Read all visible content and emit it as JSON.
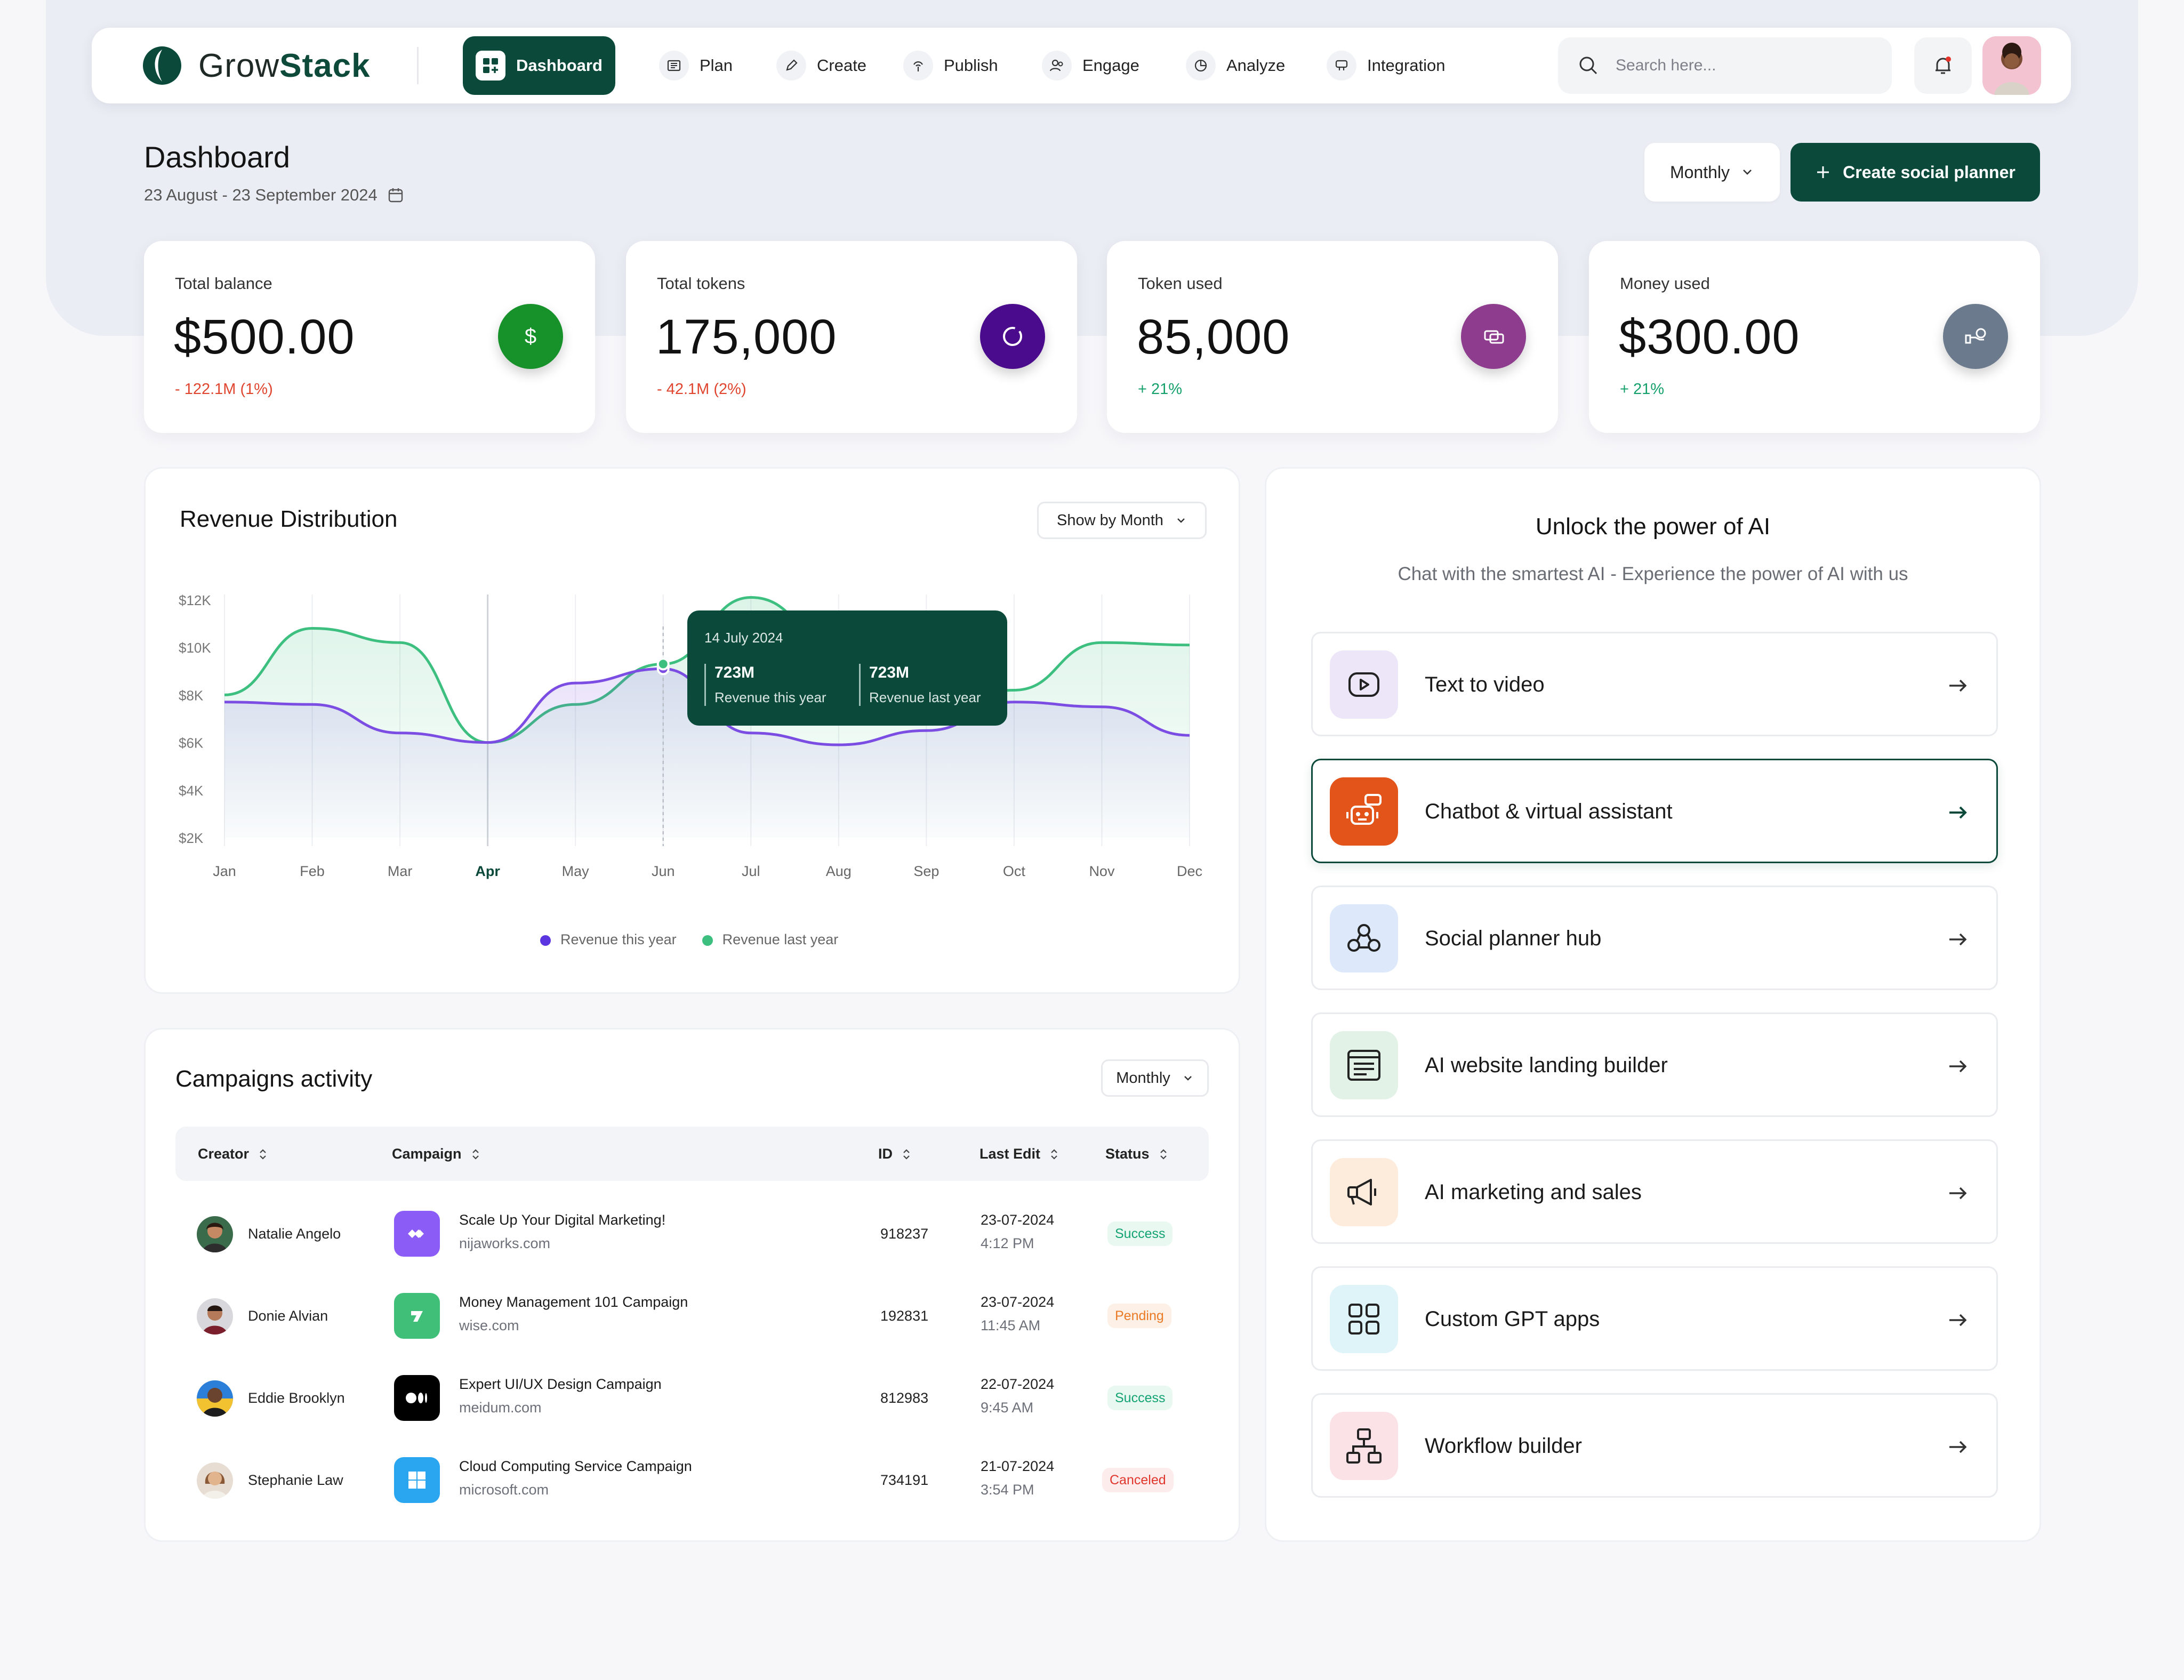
{
  "app": {
    "brand_plain": "Grow",
    "brand_bold": "Stack",
    "accent": "#0b4a3b"
  },
  "nav": {
    "items": [
      {
        "label": "Dashboard",
        "icon": "dashboard-icon",
        "active": true
      },
      {
        "label": "Plan",
        "icon": "plan-icon"
      },
      {
        "label": "Create",
        "icon": "pen-icon"
      },
      {
        "label": "Publish",
        "icon": "publish-icon"
      },
      {
        "label": "Engage",
        "icon": "users-icon"
      },
      {
        "label": "Analyze",
        "icon": "pie-chart-icon"
      },
      {
        "label": "Integration",
        "icon": "integration-icon"
      }
    ],
    "search_placeholder": "Search here..."
  },
  "header": {
    "title": "Dashboard",
    "date_range": "23 August - 23 September 2024",
    "period_label": "Monthly",
    "create_label": "Create social planner"
  },
  "stats": [
    {
      "label": "Total balance",
      "value": "$500.00",
      "change": "- 122.1M (1%)",
      "trend": "down",
      "icon": "dollar-icon",
      "icon_color": "#17912a"
    },
    {
      "label": "Total tokens",
      "value": "175,000",
      "change": "- 42.1M (2%)",
      "trend": "down",
      "icon": "token-ring-icon",
      "icon_color": "#4a0b8c"
    },
    {
      "label": "Token used",
      "value": "85,000",
      "change": "+ 21%",
      "trend": "up",
      "icon": "ticket-icon",
      "icon_color": "#8e3d8e"
    },
    {
      "label": "Money used",
      "value": "$300.00",
      "change": "+ 21%",
      "trend": "up",
      "icon": "money-hand-icon",
      "icon_color": "#6c7a8e"
    }
  ],
  "revenue": {
    "title": "Revenue Distribution",
    "filter_label": "Show by Month",
    "tooltip": {
      "date": "14 July 2024",
      "this_year_value": "723M",
      "this_year_label": "Revenue this year",
      "last_year_value": "723M",
      "last_year_label": "Revenue last year"
    }
  },
  "chart_data": {
    "type": "area",
    "categories": [
      "Jan",
      "Feb",
      "Mar",
      "Apr",
      "May",
      "Jun",
      "Jul",
      "Aug",
      "Sep",
      "Oct",
      "Nov",
      "Dec"
    ],
    "highlighted_category": "Apr",
    "series": [
      {
        "name": "Revenue this year",
        "color": "#7b4de3",
        "values": [
          7.7,
          7.6,
          6.4,
          6.0,
          8.5,
          9.1,
          6.4,
          5.9,
          6.5,
          7.7,
          7.5,
          6.3
        ]
      },
      {
        "name": "Revenue last year",
        "color": "#3cbf7f",
        "values": [
          8.0,
          10.8,
          10.2,
          6.0,
          7.6,
          9.3,
          12.1,
          10.2,
          7.4,
          8.2,
          10.2,
          10.1
        ]
      }
    ],
    "y_ticks": [
      "$2K",
      "$4K",
      "$6K",
      "$8K",
      "$10K",
      "$12K"
    ],
    "ylim": [
      2,
      12
    ],
    "grid": true,
    "legend_position": "bottom"
  },
  "campaigns": {
    "title": "Campaigns activity",
    "filter_label": "Monthly",
    "columns": [
      "Creator",
      "Campaign",
      "ID",
      "Last Edit",
      "Status"
    ],
    "rows": [
      {
        "creator": "Natalie Angelo",
        "campaign": "Scale Up Your Digital Marketing!",
        "url": "nijaworks.com",
        "id": "918237",
        "date": "23-07-2024",
        "time": "4:12 PM",
        "status": "Success",
        "logo": "nijaworks-logo-icon",
        "logo_color": "#8b5cf6"
      },
      {
        "creator": "Donie Alvian",
        "campaign": "Money Management 101 Campaign",
        "url": "wise.com",
        "id": "192831",
        "date": "23-07-2024",
        "time": "11:45 AM",
        "status": "Pending",
        "logo": "wise-logo-icon",
        "logo_color": "#3fbf78"
      },
      {
        "creator": "Eddie Brooklyn",
        "campaign": "Expert UI/UX Design Campaign",
        "url": "meidum.com",
        "id": "812983",
        "date": "22-07-2024",
        "time": "9:45 AM",
        "status": "Success",
        "logo": "medium-logo-icon",
        "logo_color": "#000000"
      },
      {
        "creator": "Stephanie Law",
        "campaign": "Cloud Computing Service Campaign",
        "url": "microsoft.com",
        "id": "734191",
        "date": "21-07-2024",
        "time": "3:54 PM",
        "status": "Canceled",
        "logo": "microsoft-logo-icon",
        "logo_color": "#2aa6f0"
      }
    ]
  },
  "ai": {
    "title": "Unlock the power of AI",
    "subtitle": "Chat with the smartest AI - Experience the power of AI with us",
    "items": [
      {
        "label": "Text to video",
        "icon": "play-video-icon",
        "bg": "#ece6f8"
      },
      {
        "label": "Chatbot & virtual assistant",
        "icon": "robot-icon",
        "bg": "#e2541a",
        "selected": true
      },
      {
        "label": "Social planner hub",
        "icon": "people-network-icon",
        "bg": "#dde9fb"
      },
      {
        "label": "AI website landing builder",
        "icon": "browser-window-icon",
        "bg": "#e2f2e7"
      },
      {
        "label": "AI marketing and sales",
        "icon": "megaphone-icon",
        "bg": "#fdecdc"
      },
      {
        "label": "Custom GPT apps",
        "icon": "apps-grid-icon",
        "bg": "#dff4f8"
      },
      {
        "label": "Workflow builder",
        "icon": "workflow-icon",
        "bg": "#fbe2e6"
      }
    ]
  }
}
